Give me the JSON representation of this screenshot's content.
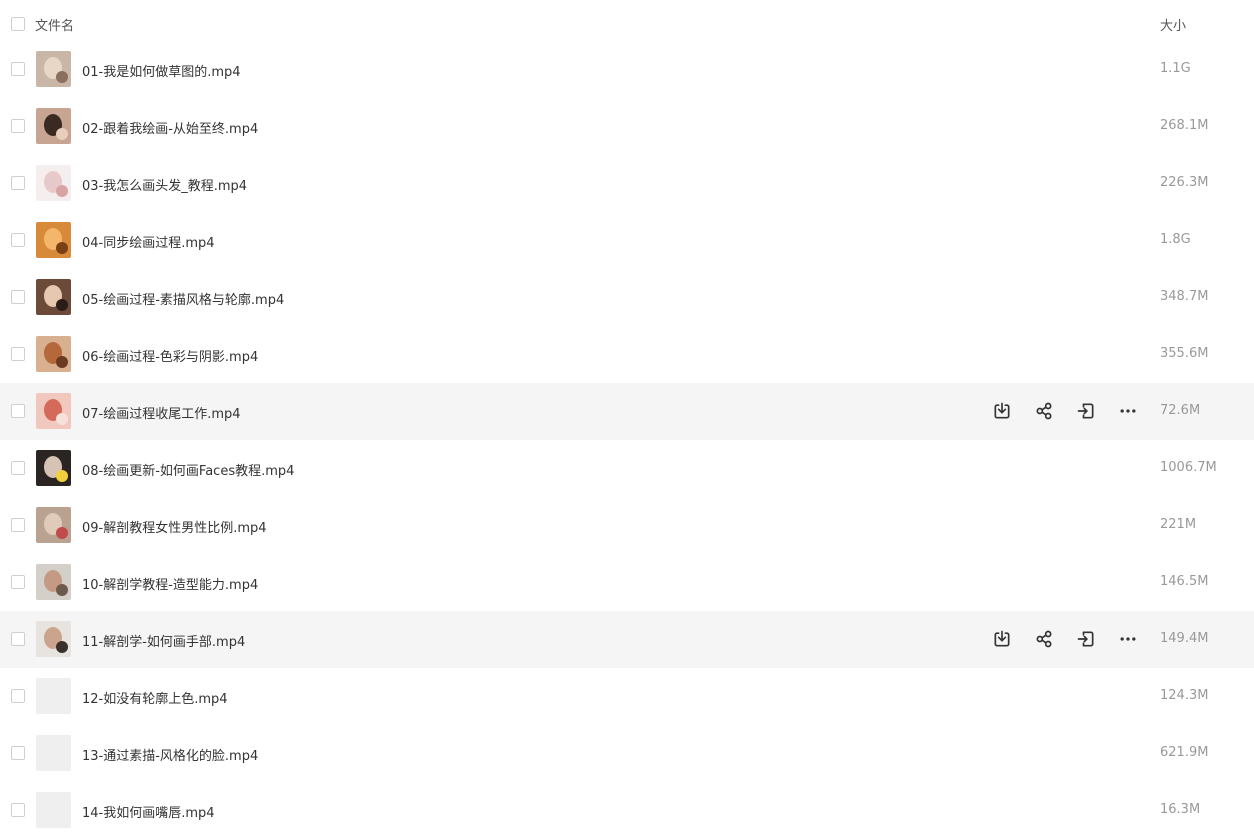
{
  "header": {
    "name_label": "文件名",
    "size_label": "大小"
  },
  "files": [
    {
      "name": "01-我是如何做草图的.mp4",
      "size": "1.1G",
      "thumb": {
        "bg": "#c9b6a6",
        "fg": "#e8d7c7",
        "accent": "#8a6f5d"
      }
    },
    {
      "name": "02-跟着我绘画-从始至终.mp4",
      "size": "268.1M",
      "thumb": {
        "bg": "#c8a592",
        "fg": "#3b2a22",
        "accent": "#e9cdbd"
      }
    },
    {
      "name": "03-我怎么画头发_教程.mp4",
      "size": "226.3M",
      "thumb": {
        "bg": "#f5eeee",
        "fg": "#e7c9c9",
        "accent": "#d9a3a3"
      }
    },
    {
      "name": "04-同步绘画过程.mp4",
      "size": "1.8G",
      "thumb": {
        "bg": "#d68a3a",
        "fg": "#f3b66b",
        "accent": "#7a3f14"
      }
    },
    {
      "name": "05-绘画过程-素描风格与轮廓.mp4",
      "size": "348.7M",
      "thumb": {
        "bg": "#6b4a3a",
        "fg": "#e6c8b0",
        "accent": "#2a1c16"
      }
    },
    {
      "name": "06-绘画过程-色彩与阴影.mp4",
      "size": "355.6M",
      "thumb": {
        "bg": "#d8b08f",
        "fg": "#b5683a",
        "accent": "#6b3a22"
      }
    },
    {
      "name": "07-绘画过程收尾工作.mp4",
      "size": "72.6M",
      "highlight": true,
      "thumb": {
        "bg": "#f1c8bd",
        "fg": "#d46a5a",
        "accent": "#f7e2da"
      }
    },
    {
      "name": "08-绘画更新-如何画Faces教程.mp4",
      "size": "1006.7M",
      "thumb": {
        "bg": "#2a2523",
        "fg": "#d7c3b4",
        "accent": "#f2d03a"
      }
    },
    {
      "name": "09-解剖教程女性男性比例.mp4",
      "size": "221M",
      "thumb": {
        "bg": "#b9a290",
        "fg": "#e0cbbb",
        "accent": "#c14a4a"
      }
    },
    {
      "name": "10-解剖学教程-造型能力.mp4",
      "size": "146.5M",
      "thumb": {
        "bg": "#d4cfc8",
        "fg": "#c49a84",
        "accent": "#6d5a4f"
      }
    },
    {
      "name": "11-解剖学-如何画手部.mp4",
      "size": "149.4M",
      "highlight": true,
      "thumb": {
        "bg": "#e7e3de",
        "fg": "#caa48c",
        "accent": "#3a302b"
      }
    },
    {
      "name": "12-如没有轮廓上色.mp4",
      "size": "124.3M",
      "thumb": {
        "bg": "#efefef",
        "fg": "#efefef",
        "accent": "#efefef"
      }
    },
    {
      "name": "13-通过素描-风格化的脸.mp4",
      "size": "621.9M",
      "thumb": {
        "bg": "#efefef",
        "fg": "#efefef",
        "accent": "#efefef"
      }
    },
    {
      "name": "14-我如何画嘴唇.mp4",
      "size": "16.3M",
      "thumb": {
        "bg": "#efefef",
        "fg": "#efefef",
        "accent": "#efefef"
      }
    }
  ],
  "row_actions": [
    "download-icon",
    "share-icon",
    "move-icon",
    "more-icon"
  ],
  "colors": {
    "highlight_bg": "#f5f5f5",
    "icon": "#333333",
    "size_text": "#999999"
  }
}
